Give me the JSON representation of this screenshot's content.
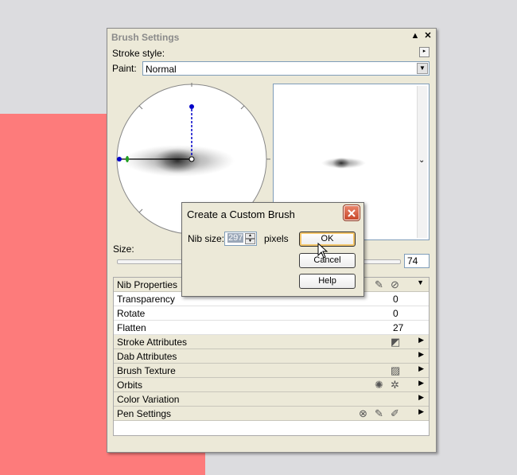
{
  "panel": {
    "title": "Brush Settings",
    "stroke_style_label": "Stroke style:",
    "paint_label": "Paint:",
    "paint_value": "Normal",
    "size_label": "Size:",
    "size_value": "74"
  },
  "properties": [
    {
      "label": "Nib Properties",
      "section": true,
      "icons": [
        "nib-edit-icon",
        "nib-disable-icon"
      ],
      "arrow": "down"
    },
    {
      "label": "Transparency",
      "value": "0"
    },
    {
      "label": "Rotate",
      "value": "0"
    },
    {
      "label": "Flatten",
      "value": "27"
    },
    {
      "label": "Stroke Attributes",
      "section": true,
      "icons": [
        "stroke-attributes-icon"
      ],
      "arrow": "right"
    },
    {
      "label": "Dab Attributes",
      "section": true,
      "icons": [],
      "arrow": "right"
    },
    {
      "label": "Brush Texture",
      "section": true,
      "icons": [
        "texture-icon"
      ],
      "arrow": "right"
    },
    {
      "label": "Orbits",
      "section": true,
      "icons": [
        "orbits-icon",
        "orbits-disable-icon"
      ],
      "arrow": "right"
    },
    {
      "label": "Color Variation",
      "section": true,
      "icons": [],
      "arrow": "right"
    },
    {
      "label": "Pen Settings",
      "section": true,
      "icons": [
        "pen-pressure-icon",
        "pen-tilt-icon",
        "pen-bearing-icon"
      ],
      "arrow": "right"
    }
  ],
  "dialog": {
    "title": "Create a Custom Brush",
    "nib_size_label": "Nib size:",
    "nib_size_value": "297",
    "units": "pixels",
    "ok_label": "OK",
    "cancel_label": "Cancel",
    "help_label": "Help"
  },
  "colors": {
    "background": "#dcdcdf",
    "salmon": "#fd7b7b",
    "panel": "#ece9d8",
    "dialog_close": "#c8482a",
    "dial_handle": "#0000c8",
    "dial_angle": "#20a020"
  }
}
